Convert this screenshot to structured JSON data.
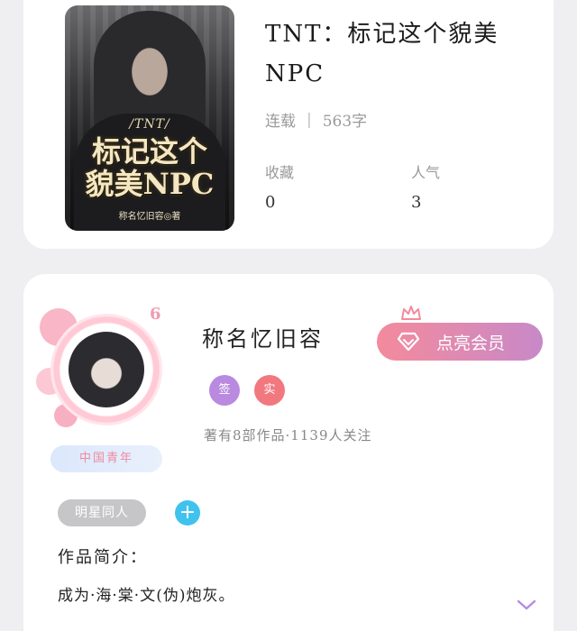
{
  "book": {
    "cover": {
      "series_tag": "/TNT/",
      "title_line1": "标记这个",
      "title_line2": "貌美NPC",
      "author_line": "称名忆旧容◎著"
    },
    "title": "TNT：标记这个貌美NPC",
    "status": "连载",
    "word_count": "563字",
    "stats": [
      {
        "label": "收藏",
        "value": "0"
      },
      {
        "label": "人气",
        "value": "3"
      }
    ]
  },
  "author": {
    "name": "称名忆旧容",
    "level": "6",
    "badge": "中国青年",
    "vip_button": {
      "label": "点亮会员",
      "icon": "diamond-icon",
      "crown_icon": "crown-icon"
    },
    "badges": [
      {
        "label": "签",
        "color": "#b98ae0"
      },
      {
        "label": "实",
        "color": "#f2787f"
      }
    ],
    "stats_text": "著有8部作品·1139人关注",
    "tag": "明星同人",
    "add_tag_label": "+",
    "intro_label": "作品简介：",
    "intro_text": "成为·海·棠·文(伪)炮灰。",
    "expand_icon": "chevron-down-icon"
  },
  "colors": {
    "vip_gradient_start": "#f48a9c",
    "vip_gradient_end": "#c889c8",
    "add_button": "#3fc3ee",
    "chevron": "#b98ae0"
  }
}
